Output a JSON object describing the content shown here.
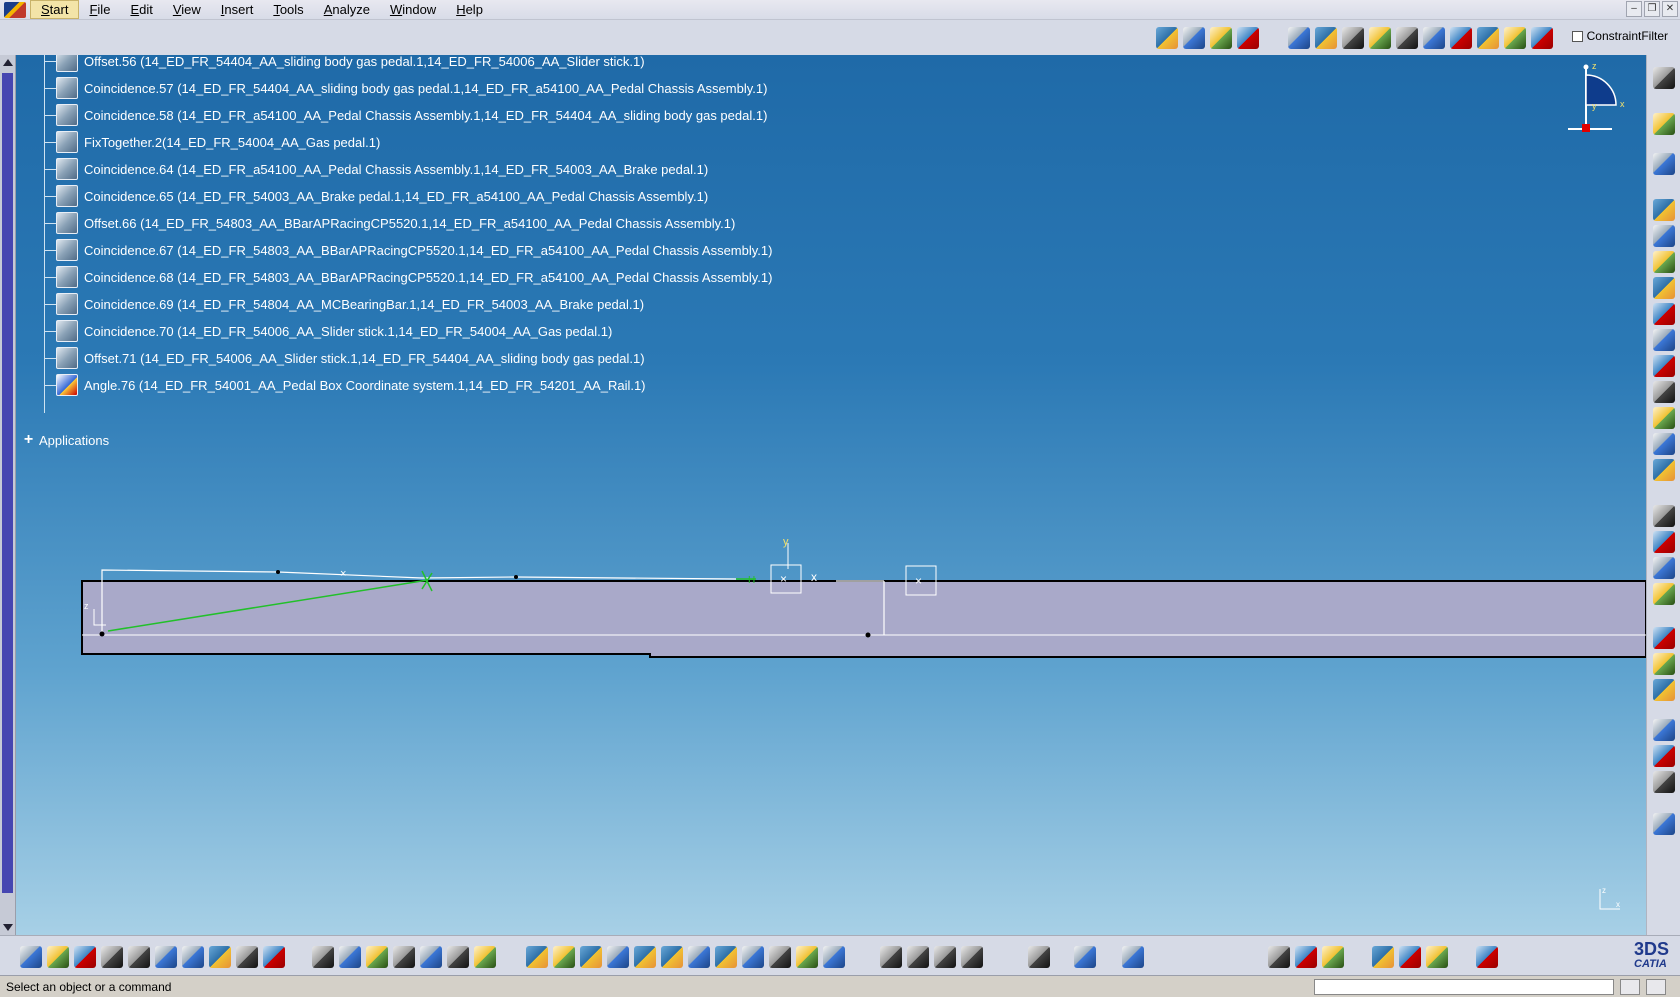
{
  "menubar": {
    "items": [
      "Start",
      "File",
      "Edit",
      "View",
      "Insert",
      "Tools",
      "Analyze",
      "Window",
      "Help"
    ],
    "window_controls": [
      "–",
      "❐",
      "✕"
    ]
  },
  "top_toolbar": {
    "constraint_filter_label": "ConstraintFilter",
    "constraint_filter_checked": false
  },
  "tree": {
    "items": [
      {
        "label": "Offset.56 (14_ED_FR_54404_AA_sliding body gas pedal.1,14_ED_FR_54006_AA_Slider stick.1)",
        "icon": "offset-constraint-icon"
      },
      {
        "label": "Coincidence.57 (14_ED_FR_54404_AA_sliding body gas pedal.1,14_ED_FR_a54100_AA_Pedal Chassis Assembly.1)",
        "icon": "coincidence-constraint-icon"
      },
      {
        "label": "Coincidence.58 (14_ED_FR_a54100_AA_Pedal Chassis Assembly.1,14_ED_FR_54404_AA_sliding body gas pedal.1)",
        "icon": "coincidence-constraint-icon"
      },
      {
        "label": "FixTogether.2(14_ED_FR_54004_AA_Gas pedal.1)",
        "icon": "fix-together-icon"
      },
      {
        "label": "Coincidence.64 (14_ED_FR_a54100_AA_Pedal Chassis Assembly.1,14_ED_FR_54003_AA_Brake pedal.1)",
        "icon": "coincidence-constraint-icon"
      },
      {
        "label": "Coincidence.65 (14_ED_FR_54003_AA_Brake pedal.1,14_ED_FR_a54100_AA_Pedal Chassis Assembly.1)",
        "icon": "coincidence-constraint-icon"
      },
      {
        "label": "Offset.66 (14_ED_FR_54803_AA_BBarAPRacingCP5520.1,14_ED_FR_a54100_AA_Pedal Chassis Assembly.1)",
        "icon": "offset-constraint-icon"
      },
      {
        "label": "Coincidence.67 (14_ED_FR_54803_AA_BBarAPRacingCP5520.1,14_ED_FR_a54100_AA_Pedal Chassis Assembly.1)",
        "icon": "coincidence-constraint-icon"
      },
      {
        "label": "Coincidence.68 (14_ED_FR_54803_AA_BBarAPRacingCP5520.1,14_ED_FR_a54100_AA_Pedal Chassis Assembly.1)",
        "icon": "coincidence-constraint-icon"
      },
      {
        "label": "Coincidence.69 (14_ED_FR_54804_AA_MCBearingBar.1,14_ED_FR_54003_AA_Brake pedal.1)",
        "icon": "coincidence-constraint-icon"
      },
      {
        "label": "Coincidence.70 (14_ED_FR_54006_AA_Slider stick.1,14_ED_FR_54004_AA_Gas pedal.1)",
        "icon": "coincidence-constraint-icon"
      },
      {
        "label": "Offset.71 (14_ED_FR_54006_AA_Slider stick.1,14_ED_FR_54404_AA_sliding body gas pedal.1)",
        "icon": "offset-constraint-icon"
      },
      {
        "label": "Angle.76 (14_ED_FR_54001_AA_Pedal Box Coordinate system.1,14_ED_FR_54201_AA_Rail.1)",
        "icon": "angle-constraint-icon"
      }
    ],
    "applications_label": "Applications",
    "applications_expander": "+"
  },
  "compass": {
    "axis_x": "x",
    "axis_y": "y",
    "axis_z": "z"
  },
  "sketch": {
    "axis_y": "y",
    "axis_x": "x",
    "axis_z": "z",
    "h_marker": "H"
  },
  "mini_axis": {
    "axis_z": "z",
    "axis_x": "x"
  },
  "catia_logo": {
    "mark": "3DS",
    "text": "CATIA"
  },
  "statusbar": {
    "message": "Select an object or a command"
  },
  "colors": {
    "viewport_top": "#1f6aa8",
    "viewport_bottom": "#a7d0e6",
    "part_fill": "#a9a9c9",
    "constraint_green": "#22c02a"
  }
}
